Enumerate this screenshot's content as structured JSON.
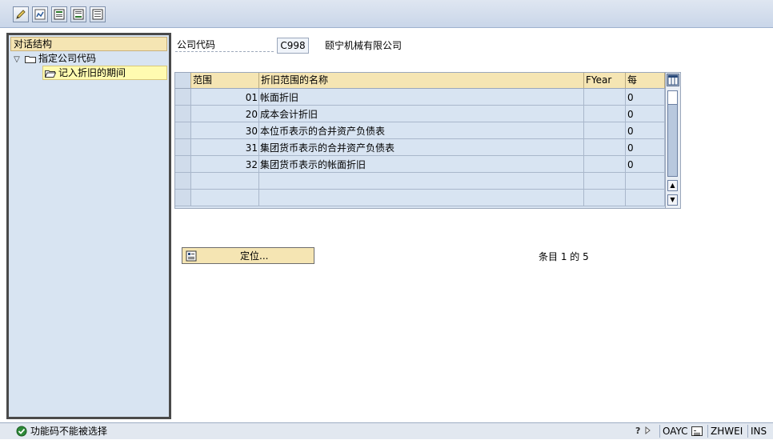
{
  "toolbar": {
    "icons": [
      "edit-icon",
      "display-change-icon",
      "prev-entry-icon",
      "next-entry-icon",
      "other-entry-icon"
    ]
  },
  "tree": {
    "header": "对话结构",
    "items": [
      {
        "label": "指定公司代码",
        "expanded": true,
        "level": 0
      },
      {
        "label": "记入折旧的期间",
        "level": 1,
        "selected": true
      }
    ]
  },
  "company": {
    "label": "公司代码",
    "code": "C998",
    "name": "颐宁机械有限公司"
  },
  "table": {
    "columns": [
      "范围",
      "折旧范围的名称",
      "FYear",
      "每"
    ],
    "rows": [
      {
        "range": "01",
        "name": "帐面折旧",
        "fyear": "",
        "each": "0"
      },
      {
        "range": "20",
        "name": "成本会计折旧",
        "fyear": "",
        "each": "0"
      },
      {
        "range": "30",
        "name": "本位币表示的合并资产负债表",
        "fyear": "",
        "each": "0"
      },
      {
        "range": "31",
        "name": "集团货币表示的合并资产负债表",
        "fyear": "",
        "each": "0"
      },
      {
        "range": "32",
        "name": "集团货币表示的帐面折旧",
        "fyear": "",
        "each": "0"
      },
      {
        "range": "",
        "name": "",
        "fyear": "",
        "each": ""
      },
      {
        "range": "",
        "name": "",
        "fyear": "",
        "each": ""
      }
    ]
  },
  "position_button": {
    "label": "定位..."
  },
  "entry_count": "条目 1 的 5",
  "status": {
    "message": "功能码不能被选择",
    "transaction": "OAYC",
    "user": "ZHWEI",
    "mode": "INS"
  },
  "colors": {
    "header_bg": "#f5e5b3",
    "table_bg": "#d8e4f2",
    "selected_node": "#fffbb0"
  }
}
